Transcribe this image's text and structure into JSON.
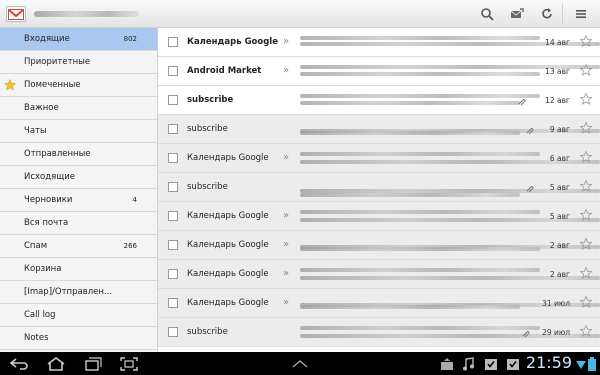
{
  "sidebar": {
    "folders": [
      {
        "label": "Входящие",
        "count": "802"
      },
      {
        "label": "Приоритетные",
        "count": ""
      },
      {
        "label": "Помеченные",
        "count": ""
      },
      {
        "label": "Важное",
        "count": ""
      },
      {
        "label": "Чаты",
        "count": ""
      },
      {
        "label": "Отправленные",
        "count": ""
      },
      {
        "label": "Исходящие",
        "count": ""
      },
      {
        "label": "Черновики",
        "count": "4"
      },
      {
        "label": "Вся почта",
        "count": ""
      },
      {
        "label": "Спам",
        "count": "266"
      },
      {
        "label": "Корзина",
        "count": ""
      },
      {
        "label": "[Imap]/Отправлен...",
        "count": ""
      },
      {
        "label": "Call log",
        "count": ""
      },
      {
        "label": "Notes",
        "count": ""
      }
    ]
  },
  "messages": [
    {
      "sender": "Календарь Google",
      "date": "14 авг"
    },
    {
      "sender": "Android Market",
      "date": "13 авг"
    },
    {
      "sender": "subscribe",
      "date": "12 авг"
    },
    {
      "sender": "subscribe",
      "date": "9 авг"
    },
    {
      "sender": "Календарь Google",
      "date": "6 авг"
    },
    {
      "sender": "subscribe",
      "date": "5 авг"
    },
    {
      "sender": "Календарь Google",
      "date": "5 авг"
    },
    {
      "sender": "Календарь Google",
      "date": "2 авг"
    },
    {
      "sender": "Календарь Google",
      "date": "2 авг"
    },
    {
      "sender": "Календарь Google",
      "date": "31 июл"
    },
    {
      "sender": "subscribe",
      "date": "29 июл"
    }
  ],
  "statusbar": {
    "time": "21:59"
  },
  "colors": {
    "selected": "#a9c8ef",
    "star_active": "#f2c530",
    "read_row": "#ececec"
  },
  "icons": [
    "gmail-logo-icon",
    "search-icon",
    "compose-icon",
    "refresh-icon",
    "menu-icon",
    "back-icon",
    "home-icon",
    "recent-apps-icon",
    "screenshot-icon",
    "up-arrow-icon",
    "music-icon",
    "task-icon",
    "wifi-icon",
    "battery-icon"
  ]
}
